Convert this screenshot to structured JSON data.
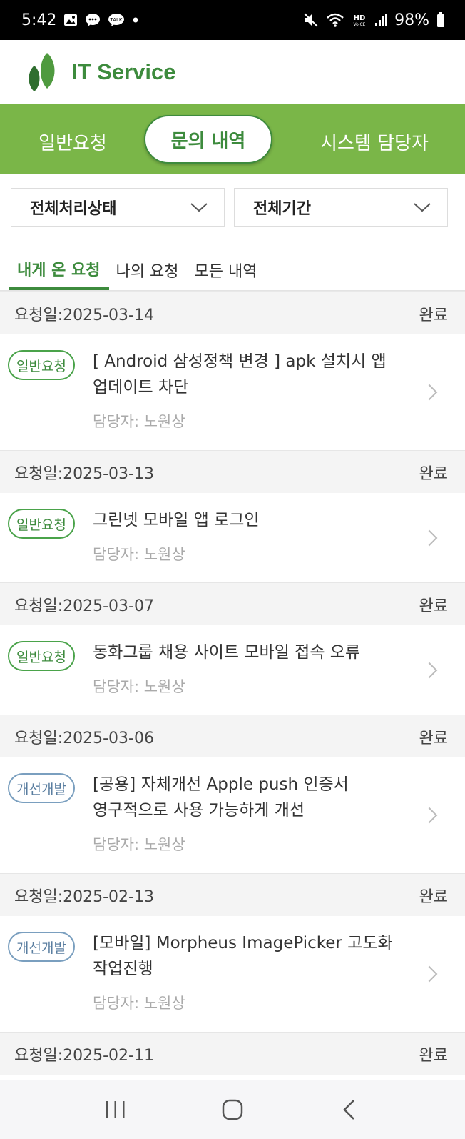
{
  "status_bar": {
    "time": "5:42",
    "left_icons": [
      "image-icon",
      "chat-bubble-icon",
      "talk-icon",
      "dot-icon"
    ],
    "right_icons": [
      "mute-icon",
      "wifi-icon",
      "hd-voice-icon",
      "signal-icon"
    ],
    "battery": "98%"
  },
  "header": {
    "title": "IT Service",
    "logo": "leaf-logo",
    "brand_color": "#3d8b3d"
  },
  "nav": {
    "tabs": [
      {
        "label": "일반요청",
        "active": false
      },
      {
        "label": "문의 내역",
        "active": true
      },
      {
        "label": "시스템 담당자",
        "active": false
      }
    ],
    "bar_color": "#7ab648"
  },
  "filters": {
    "status": "전체처리상태",
    "period": "전체기간"
  },
  "subtabs": [
    {
      "label": "내게 온 요청",
      "active": true
    },
    {
      "label": "나의 요청",
      "active": false
    },
    {
      "label": "모든 내역",
      "active": false
    }
  ],
  "items": [
    {
      "date_row": "요청일:2025-03-14",
      "status": "완료",
      "badge": "일반요청",
      "title_lines": [
        "[ Android 삼성정책 변경 ] apk 설치시 앱",
        "업데이트 차단"
      ],
      "assignee": "담당자: 노원상"
    },
    {
      "date_row": "요청일:2025-03-13",
      "status": "완료",
      "badge": "일반요청",
      "title_lines": [
        "그린넷 모바일 앱 로그인"
      ],
      "assignee": "담당자: 노원상"
    },
    {
      "date_row": "요청일:2025-03-07",
      "status": "완료",
      "badge": "일반요청",
      "title_lines": [
        "동화그룹 채용 사이트 모바일 접속 오류"
      ],
      "assignee": "담당자: 노원상"
    },
    {
      "date_row": "요청일:2025-03-06",
      "status": "완료",
      "badge": "개선개발",
      "title_lines": [
        "[공용] 자체개선 Apple push 인증서",
        "영구적으로 사용 가능하게 개선"
      ],
      "assignee": "담당자: 노원상"
    },
    {
      "date_row": "요청일:2025-02-13",
      "status": "완료",
      "badge": "개선개발",
      "title_lines": [
        "[모바일] Morpheus ImagePicker 고도화",
        "작업진행"
      ],
      "assignee": "담당자: 노원상"
    }
  ],
  "last_date_row": {
    "date_row": "요청일:2025-02-11",
    "status": "완료"
  },
  "bottom_nav": [
    "recent-apps-icon",
    "home-icon",
    "back-icon"
  ]
}
